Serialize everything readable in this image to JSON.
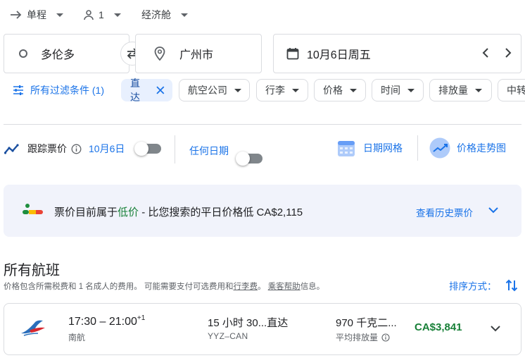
{
  "trip": {
    "type": "单程",
    "passengers": "1",
    "cabin": "经济舱"
  },
  "search": {
    "origin": "多伦多",
    "destination": "广州市",
    "date": "10月6日周五"
  },
  "filters": {
    "all_filters": "所有过滤条件 (1)",
    "chips": [
      "直达",
      "航空公司",
      "行李",
      "价格",
      "时间",
      "排放量",
      "中转"
    ]
  },
  "tracking": {
    "label": "跟踪票价",
    "date_label": "10月6日",
    "any_date_label": "任何日期",
    "date_grid": "日期网格",
    "price_graph": "价格走势图"
  },
  "insight": {
    "prefix": "票价目前属于",
    "level": "低价",
    "suffix": " - 比您搜索的平日价格低 CA$2,115",
    "history_link": "查看历史票价"
  },
  "results": {
    "title": "所有航班",
    "note_a": "价格包含所需税费和 1 名成人的费用。 可能需要支付可选费用和",
    "note_link1": "行李费",
    "note_b": "。 ",
    "note_link2": "乘客帮助",
    "note_c": "信息。",
    "sort_label": "排序方式："
  },
  "flights": [
    {
      "depart": "17:30",
      "dash": " – ",
      "arrive": "21:00",
      "day_offset": "+1",
      "airline": "南航",
      "duration": "15 小时 30...",
      "stops": "直达",
      "route": "YYZ–CAN",
      "emissions": "970 千克二...",
      "emissions_note": "平均排放量",
      "price": "CA$3,841"
    }
  ],
  "colors": {
    "accent": "#1a73e8",
    "price_green": "#188038",
    "low_price_green": "#188038"
  }
}
